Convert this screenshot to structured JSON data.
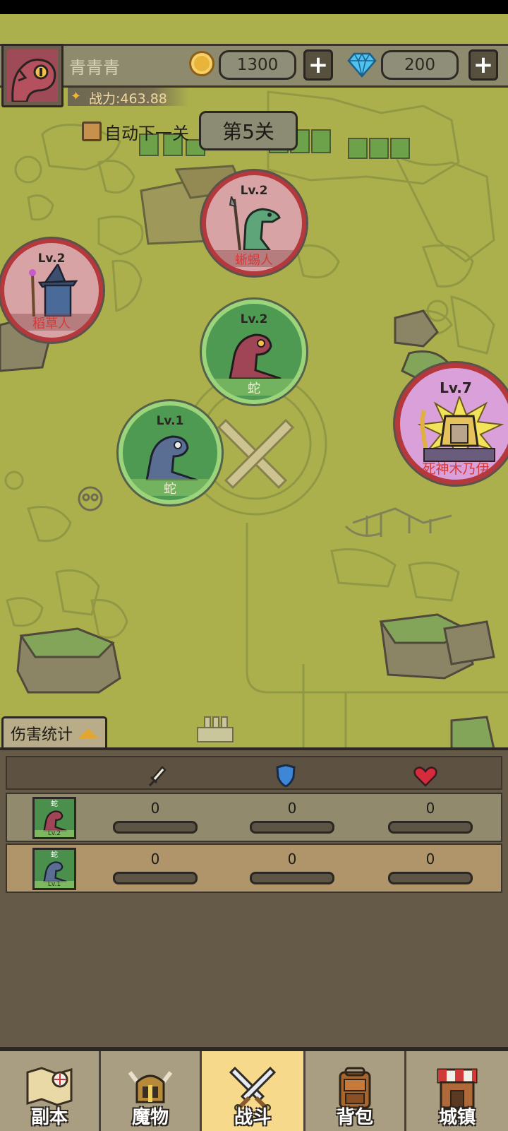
{
  "player": {
    "name": "青青青",
    "power": "战力:463.88"
  },
  "currency": {
    "gold": "1300",
    "gems": "200",
    "plus_symbol": "+"
  },
  "battle": {
    "auto_next_label": "自动下一关",
    "auto_next_checked": false,
    "stage_label": "第5关"
  },
  "enemies": [
    {
      "level": "Lv.2",
      "name": "蜥蜴人",
      "icon": "lizardman-spear-icon"
    },
    {
      "level": "Lv.2",
      "name": "稻草人",
      "icon": "scarecrow-wizard-icon"
    },
    {
      "level": "Lv.7",
      "name": "死神木乃伊",
      "icon": "death-mummy-icon"
    }
  ],
  "allies": [
    {
      "level": "Lv.2",
      "name": "蛇",
      "icon": "red-snake-icon"
    },
    {
      "level": "Lv.1",
      "name": "蛇",
      "icon": "blue-snake-icon"
    }
  ],
  "damage_stats": {
    "tab_label": "伤害统计",
    "columns": [
      "attack-sword-icon",
      "defense-shield-icon",
      "health-heart-icon"
    ],
    "rows": [
      {
        "unit_name": "蛇",
        "unit_level": "Lv.2",
        "attack": "0",
        "defense": "0",
        "health": "0",
        "attack_fill": 0,
        "defense_fill": 0,
        "health_fill": 0
      },
      {
        "unit_name": "蛇",
        "unit_level": "Lv.1",
        "attack": "0",
        "defense": "0",
        "health": "0",
        "attack_fill": 0,
        "defense_fill": 0,
        "health_fill": 0
      }
    ]
  },
  "nav": {
    "items": [
      {
        "label": "副本",
        "icon": "dungeon-map-icon",
        "active": false
      },
      {
        "label": "魔物",
        "icon": "monster-helmet-icon",
        "active": false
      },
      {
        "label": "战斗",
        "icon": "crossed-swords-icon",
        "active": true
      },
      {
        "label": "背包",
        "icon": "backpack-icon",
        "active": false
      },
      {
        "label": "城镇",
        "icon": "town-shop-icon",
        "active": false
      }
    ]
  },
  "colors": {
    "map_bg": "#abb04d",
    "enemy_ring": "#b5383c",
    "ally_ring": "#9bd47b",
    "active_tab": "#f6d98a",
    "enemy_name": "#d23a3a"
  }
}
